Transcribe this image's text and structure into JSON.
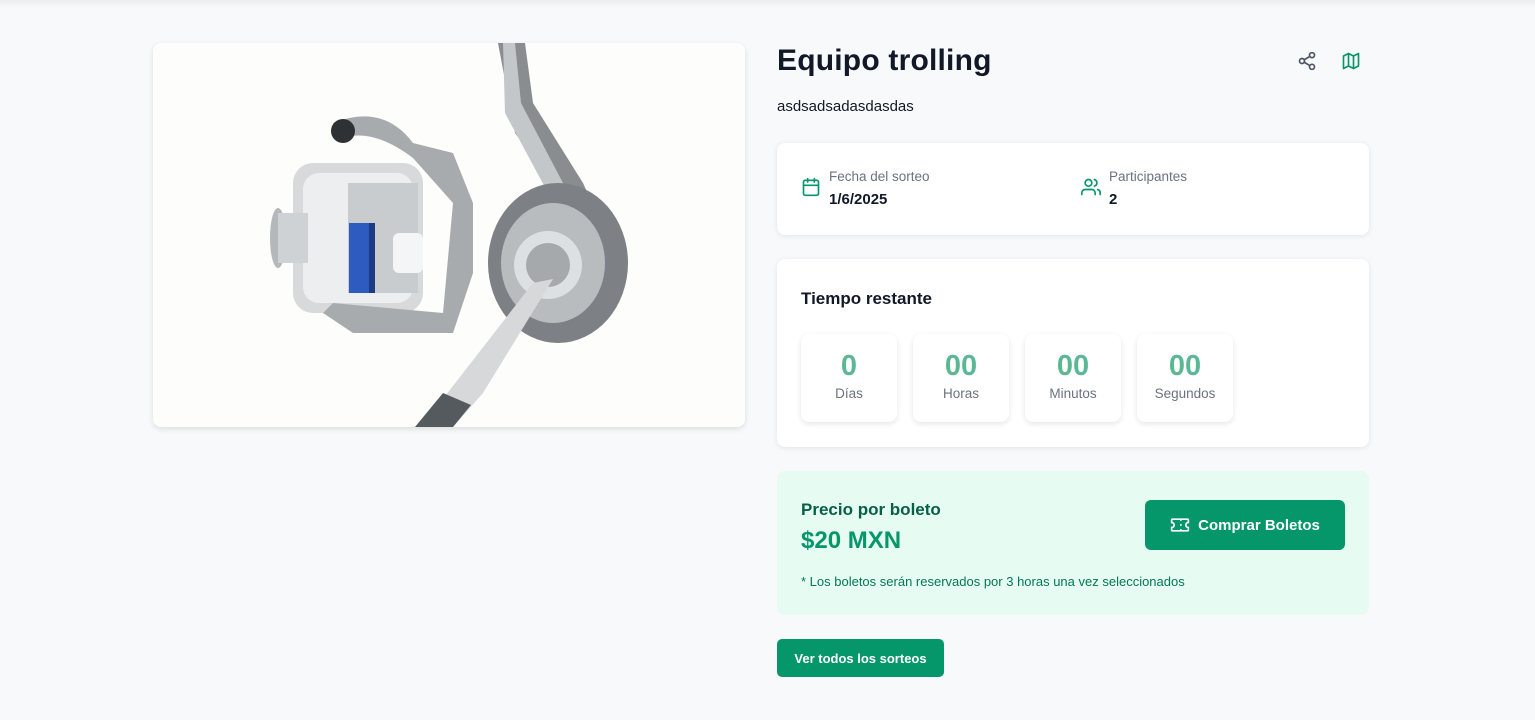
{
  "raffle": {
    "title": "Equipo trolling",
    "description": "asdsadsadasdasdas"
  },
  "icons": {
    "share": "share-icon",
    "map": "map-icon",
    "calendar": "calendar-icon",
    "participants": "users-icon",
    "ticket": "ticket-icon"
  },
  "info": {
    "date_label": "Fecha del sorteo",
    "date_value": "1/6/2025",
    "participants_label": "Participantes",
    "participants_value": "2"
  },
  "timer": {
    "title": "Tiempo restante",
    "days": "0",
    "days_label": "Días",
    "hours": "00",
    "hours_label": "Horas",
    "minutes": "00",
    "minutes_label": "Minutos",
    "seconds": "00",
    "seconds_label": "Segundos"
  },
  "price": {
    "label": "Precio por boleto",
    "value": "$20 MXN",
    "note": "* Los boletos serán reservados por 3 horas una vez seleccionados",
    "buy_button": "Comprar Boletos"
  },
  "actions": {
    "all_raffles": "Ver todos los sorteos"
  },
  "colors": {
    "accent": "#059669",
    "timer_number": "#5cb894",
    "price_bg": "#e6fbf1"
  }
}
